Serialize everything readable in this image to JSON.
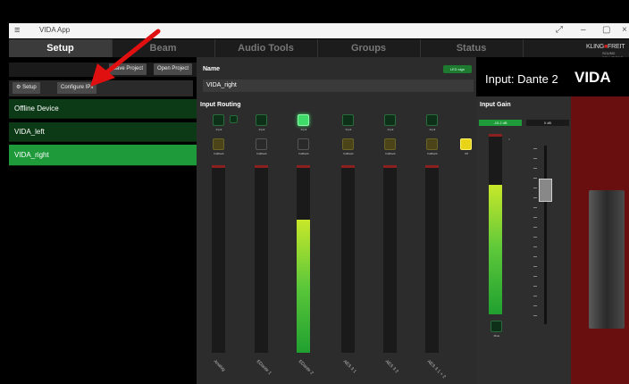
{
  "window": {
    "title": "VIDA App",
    "menu_icon": "≡",
    "controls": {
      "expand": "⤢",
      "minimize": "–",
      "maximize": "▢",
      "close": "×"
    }
  },
  "tabs": [
    {
      "label": "Setup",
      "active": true
    },
    {
      "label": "Beam",
      "active": false
    },
    {
      "label": "Audio Tools",
      "active": false
    },
    {
      "label": "Groups",
      "active": false
    },
    {
      "label": "Status",
      "active": false
    }
  ],
  "brand": {
    "left": "KLING",
    "right": "FREIT",
    "sub": "SOUND SOLUTIONS"
  },
  "left_panel": {
    "save_project": "Save Project",
    "open_project": "Open Project",
    "setup_button": "Setup",
    "configure_ips_button": "Configure IPs",
    "devices": [
      {
        "label": "Offline Device",
        "selected": false
      },
      {
        "label": "VIDA_left",
        "selected": false
      },
      {
        "label": "VIDA_right",
        "selected": true
      }
    ]
  },
  "center": {
    "name_label": "Name",
    "name_value": "VIDA_right",
    "led_button": "LED sign",
    "input_routing_label": "Input Routing",
    "input_btn_label": "Input",
    "fallback_btn_label": "Fallback",
    "off_label": "Off",
    "channels": [
      {
        "label": "Analog",
        "input_active": false,
        "level": 0
      },
      {
        "label": "EDante 1",
        "input_active": false,
        "level": 0
      },
      {
        "label": "EDante 2",
        "input_active": true,
        "level": 0.72
      },
      {
        "label": "AES 3 1",
        "input_active": false,
        "level": 0
      },
      {
        "label": "AES 3 2",
        "input_active": false,
        "level": 0
      },
      {
        "label": "AES 3 1 + 2",
        "input_active": false,
        "level": 0
      }
    ]
  },
  "right": {
    "input_title": "Input: Dante 2",
    "vida_logo": "VIDA",
    "input_gain_label": "Input Gain",
    "gain_value": "-15.2 dB",
    "gain_value2": "0 dB",
    "mute_label": "Mute",
    "meter_level": 0.73
  },
  "colors": {
    "accent_green": "#1f9a3a",
    "red_panel": "#6a0f0f",
    "arrow": "#e01010"
  }
}
